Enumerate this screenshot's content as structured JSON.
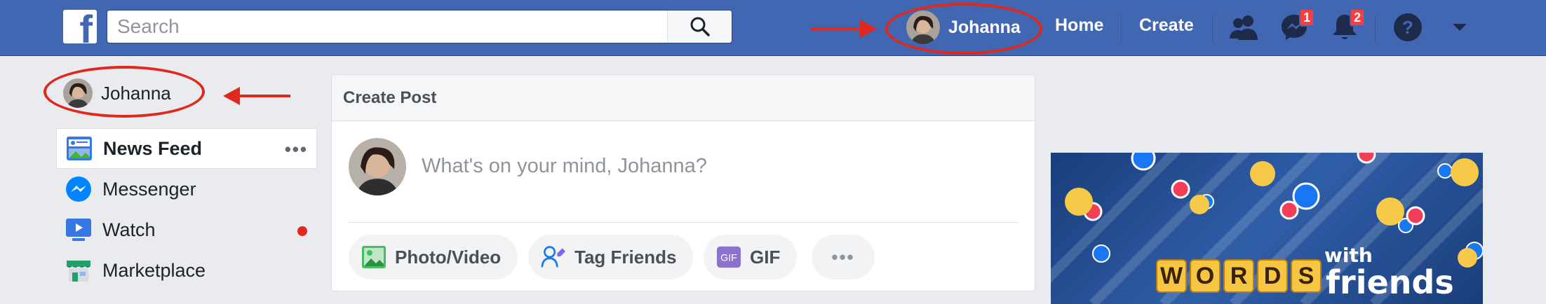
{
  "topbar": {
    "search_placeholder": "Search",
    "profile_name": "Johanna",
    "home_label": "Home",
    "create_label": "Create",
    "messages_count": "1",
    "notifications_count": "2"
  },
  "sidebar": {
    "profile_name": "Johanna",
    "items": [
      {
        "label": "News Feed",
        "icon": "news-feed-icon"
      },
      {
        "label": "Messenger",
        "icon": "messenger-icon"
      },
      {
        "label": "Watch",
        "icon": "watch-icon"
      },
      {
        "label": "Marketplace",
        "icon": "marketplace-icon"
      }
    ],
    "more_label": "•••"
  },
  "composer": {
    "title": "Create Post",
    "placeholder": "What's on your mind, Johanna?",
    "actions": [
      {
        "label": "Photo/Video",
        "icon": "photo-video-icon"
      },
      {
        "label": "Tag Friends",
        "icon": "tag-friends-icon"
      },
      {
        "label": "GIF",
        "icon": "gif-icon"
      }
    ],
    "more_label": "•••"
  },
  "ad": {
    "letters": [
      "W",
      "O",
      "R",
      "D",
      "S"
    ],
    "with_text": "with",
    "friends_text": "friends"
  },
  "colors": {
    "brand": "#4267b2",
    "annotation": "#e0281c",
    "badge": "#fa3e3e"
  }
}
